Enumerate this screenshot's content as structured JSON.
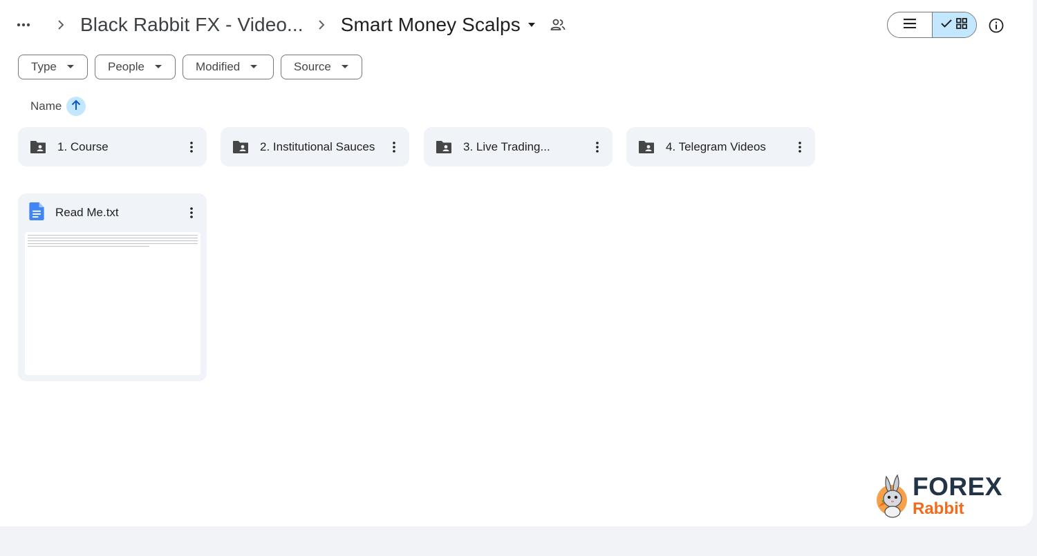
{
  "breadcrumb": {
    "more_icon": "more-horiz-icon",
    "parent": "Black Rabbit FX - Video...",
    "current": "Smart Money Scalps"
  },
  "view_toggle": {
    "list_icon": "list-icon",
    "grid_icon": "grid-icon",
    "active": "grid"
  },
  "filters": [
    "Type",
    "People",
    "Modified",
    "Source"
  ],
  "sort": {
    "label": "Name",
    "direction": "ascending"
  },
  "folders": [
    {
      "name": "1. Course",
      "icon": "shared-folder-icon"
    },
    {
      "name": "2. Institutional Sauces",
      "icon": "shared-folder-icon"
    },
    {
      "name": "3. Live Trading...",
      "icon": "shared-folder-icon"
    },
    {
      "name": "4. Telegram Videos",
      "icon": "shared-folder-icon"
    }
  ],
  "files": [
    {
      "name": "Read Me.txt",
      "icon": "google-docs-icon"
    }
  ],
  "watermark": {
    "line1": "FOREX",
    "line2": "Rabbit"
  },
  "colors": {
    "accent": "#c2e7ff",
    "card_bg": "#f0f4f9",
    "brand_dark": "#243447",
    "brand_orange": "#f26b1d"
  }
}
